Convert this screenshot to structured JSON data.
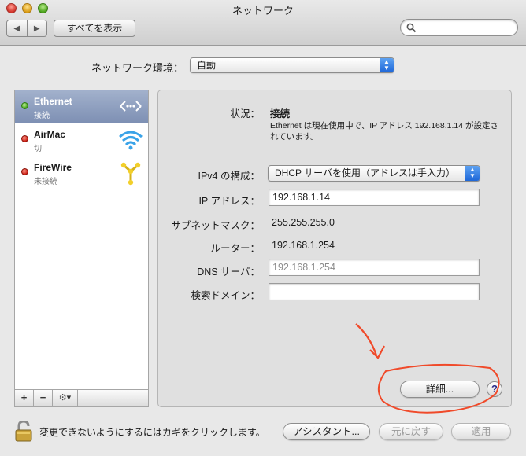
{
  "window": {
    "title": "ネットワーク",
    "show_all_label": "すべてを表示",
    "search_placeholder": ""
  },
  "location": {
    "label": "ネットワーク環境：",
    "value": "自動"
  },
  "services": [
    {
      "name": "Ethernet",
      "status": "接続",
      "status_color": "green",
      "icon": "ethernet-icon",
      "selected": true
    },
    {
      "name": "AirMac",
      "status": "切",
      "status_color": "red",
      "icon": "wifi-icon",
      "selected": false
    },
    {
      "name": "FireWire",
      "status": "未接続",
      "status_color": "red",
      "icon": "firewire-icon",
      "selected": false
    }
  ],
  "sidebar_buttons": {
    "add": "+",
    "remove": "−",
    "gear": "⚙▾"
  },
  "details": {
    "status_label": "状況：",
    "status_value": "接続",
    "status_description": "Ethernet は現在使用中で、IP アドレス 192.168.1.14 が設定されています。",
    "ipv4_label": "IPv4 の構成：",
    "ipv4_value": "DHCP サーバを使用（アドレスは手入力）",
    "ip_label": "IP アドレス：",
    "ip_value": "192.168.1.14",
    "subnet_label": "サブネットマスク：",
    "subnet_value": "255.255.255.0",
    "router_label": "ルーター：",
    "router_value": "192.168.1.254",
    "dns_label": "DNS サーバ：",
    "dns_value": "192.168.1.254",
    "search_domain_label": "検索ドメイン：",
    "search_domain_value": "",
    "advanced_button": "詳細...",
    "help_button": "?"
  },
  "footer": {
    "lock_text": "変更できないようにするにはカギをクリックします。",
    "assistant_button": "アシスタント...",
    "revert_button": "元に戻す",
    "apply_button": "適用"
  },
  "colors": {
    "selection": "#8e9fc0",
    "annotation": "#f04a2a",
    "status_green": "#3c9c14",
    "status_red": "#c81a10"
  }
}
